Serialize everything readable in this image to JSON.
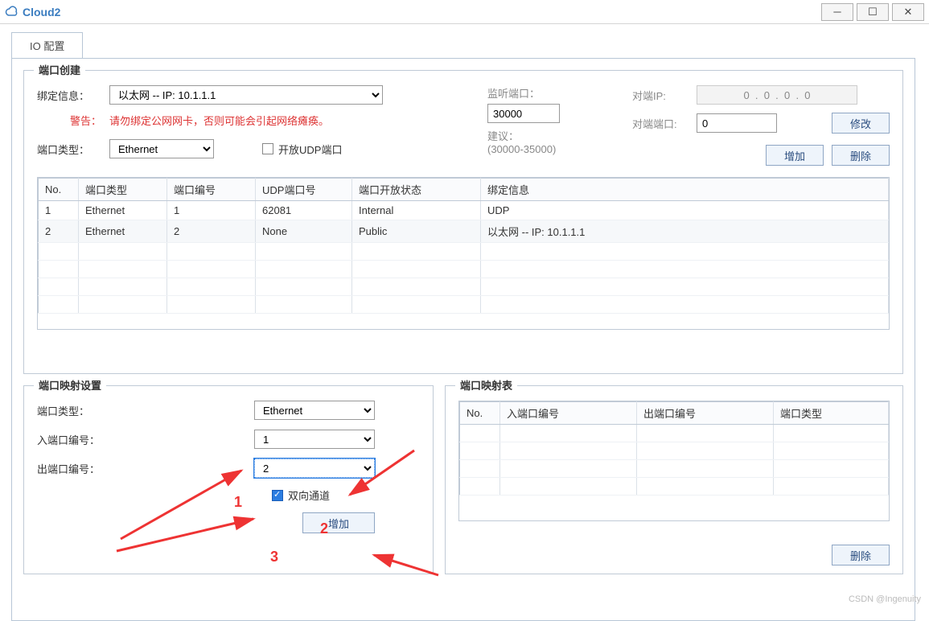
{
  "titlebar": {
    "title": "Cloud2"
  },
  "tab": {
    "io_config": "IO 配置"
  },
  "section_create": {
    "legend": "端口创建",
    "bind_label": "绑定信息：",
    "bind_value": "以太网 -- IP: 10.1.1.1",
    "warn_label": "警告：",
    "warn_text": "请勿绑定公网网卡，否则可能会引起网络瘫痪。",
    "type_label": "端口类型：",
    "type_value": "Ethernet",
    "open_udp_label": "开放UDP端口",
    "listen_label": "监听端口：",
    "listen_value": "30000",
    "suggest_label": "建议：",
    "suggest_range": "(30000-35000)",
    "peer_ip_label": "对端IP:",
    "peer_ip_value": "0  .  0  .  0  .  0",
    "peer_port_label": "对端端口:",
    "peer_port_value": "0",
    "modify_btn": "修改",
    "add_btn": "增加",
    "del_btn": "删除",
    "table": {
      "headers": [
        "No.",
        "端口类型",
        "端口编号",
        "UDP端口号",
        "端口开放状态",
        "绑定信息"
      ],
      "rows": [
        [
          "1",
          "Ethernet",
          "1",
          "62081",
          "Internal",
          "UDP"
        ],
        [
          "2",
          "Ethernet",
          "2",
          "None",
          "Public",
          "以太网 -- IP: 10.1.1.1"
        ]
      ]
    }
  },
  "section_map_set": {
    "legend": "端口映射设置",
    "type_label": "端口类型：",
    "type_value": "Ethernet",
    "in_label": "入端口编号：",
    "in_value": "1",
    "out_label": "出端口编号：",
    "out_value": "2",
    "bidir_label": "双向通道",
    "add_btn": "增加"
  },
  "section_map_tbl": {
    "legend": "端口映射表",
    "headers": [
      "No.",
      "入端口编号",
      "出端口编号",
      "端口类型"
    ],
    "del_btn": "删除"
  },
  "annotations": {
    "one": "1",
    "two": "2",
    "three": "3"
  },
  "watermark": "CSDN @Ingenuity"
}
